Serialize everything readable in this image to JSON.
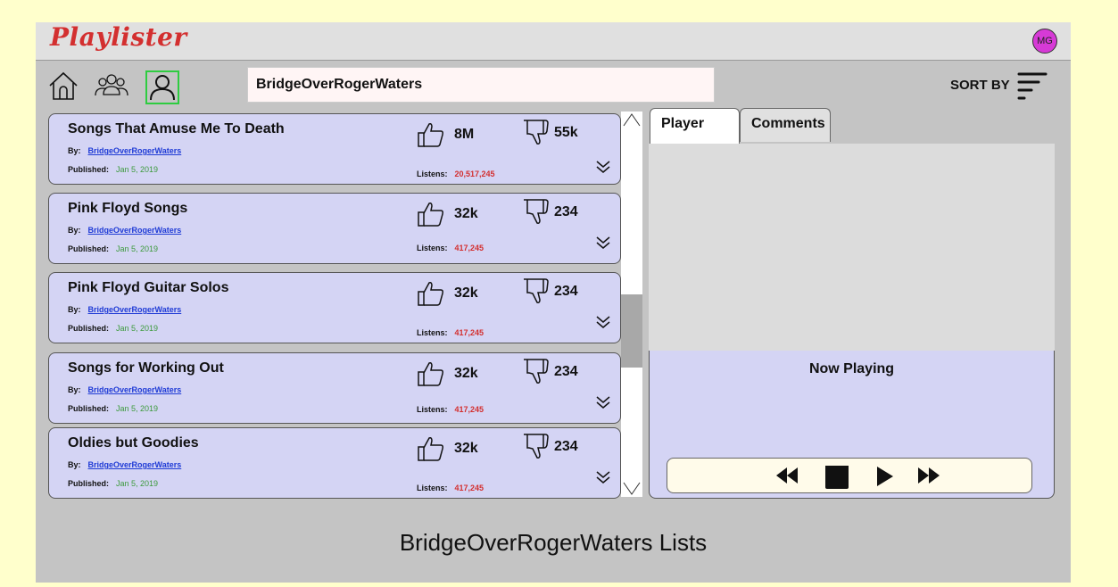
{
  "app": {
    "logo": "Playlister",
    "avatar_initials": "MG"
  },
  "toolbar": {
    "search_value": "BridgeOverRogerWaters",
    "sort_label": "SORT BY"
  },
  "playlists": [
    {
      "name": "Songs That Amuse Me To Death",
      "by_label": "By:",
      "author": "BridgeOverRogerWaters",
      "published_label": "Published:",
      "published": "Jan 5, 2019",
      "listens_label": "Listens:",
      "listens": "20,517,245",
      "likes": "8M",
      "dislikes": "55k"
    },
    {
      "name": "Pink Floyd Songs",
      "by_label": "By:",
      "author": "BridgeOverRogerWaters",
      "published_label": "Published:",
      "published": "Jan 5, 2019",
      "listens_label": "Listens:",
      "listens": "417,245",
      "likes": "32k",
      "dislikes": "234"
    },
    {
      "name": "Pink Floyd Guitar Solos",
      "by_label": "By:",
      "author": "BridgeOverRogerWaters",
      "published_label": "Published:",
      "published": "Jan 5, 2019",
      "listens_label": "Listens:",
      "listens": "417,245",
      "likes": "32k",
      "dislikes": "234"
    },
    {
      "name": "Songs for Working Out",
      "by_label": "By:",
      "author": "BridgeOverRogerWaters",
      "published_label": "Published:",
      "published": "Jan 5, 2019",
      "listens_label": "Listens:",
      "listens": "417,245",
      "likes": "32k",
      "dislikes": "234"
    },
    {
      "name": "Oldies but Goodies",
      "by_label": "By:",
      "author": "BridgeOverRogerWaters",
      "published_label": "Published:",
      "published": "Jan 5, 2019",
      "listens_label": "Listens:",
      "listens": "417,245",
      "likes": "32k",
      "dislikes": "234"
    }
  ],
  "tabs": {
    "player": "Player",
    "comments": "Comments"
  },
  "player": {
    "now_playing_label": "Now Playing"
  },
  "footer": {
    "title": "BridgeOverRogerWaters Lists"
  },
  "colors": {
    "accent": "#d32f2f",
    "card_bg": "#d4d4f4",
    "link": "#1f3bd6",
    "published": "#3c9a3c",
    "avatar": "#d63ad6",
    "selected_nav": "#2ecc40"
  },
  "icons": [
    "home-icon",
    "groups-icon",
    "user-icon",
    "sort-icon",
    "thumbs-up-icon",
    "thumbs-down-icon",
    "chevron-double-down-icon",
    "rewind-icon",
    "stop-icon",
    "play-icon",
    "fast-forward-icon"
  ]
}
